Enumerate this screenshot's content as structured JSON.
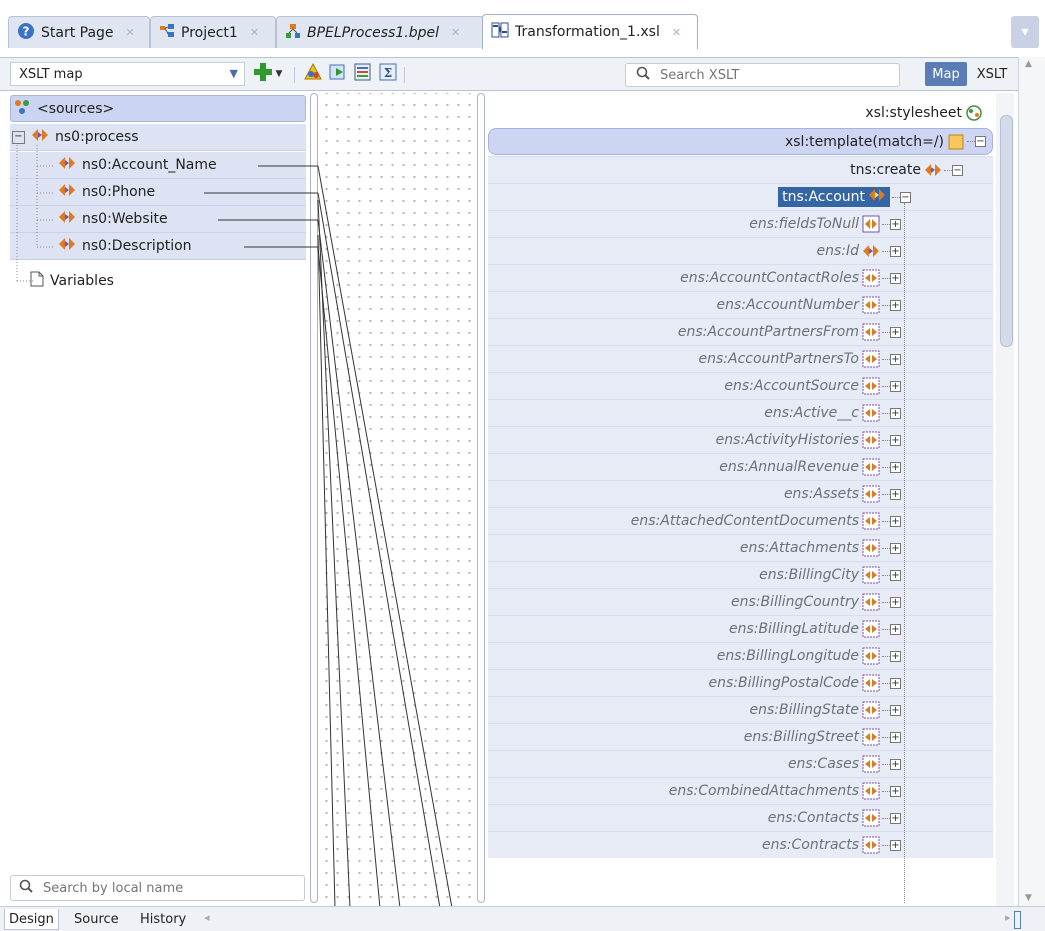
{
  "tabs": [
    {
      "label": "Start Page",
      "italic": false,
      "icon": "help-circle-icon"
    },
    {
      "label": "Project1",
      "italic": false,
      "icon": "project-icon"
    },
    {
      "label": "BPELProcess1.bpel",
      "italic": true,
      "icon": "bpel-process-icon"
    },
    {
      "label": "Transformation_1.xsl",
      "italic": false,
      "icon": "xsl-mapper-icon"
    }
  ],
  "toolbar": {
    "view_select": "XSLT map",
    "search_placeholder": "Search XSLT",
    "map_label": "Map",
    "xslt_label": "XSLT"
  },
  "source_tree": {
    "root": "<sources>",
    "process": "ns0:process",
    "elements": [
      "ns0:Account_Name",
      "ns0:Phone",
      "ns0:Website",
      "ns0:Description"
    ],
    "variables": "Variables",
    "search_placeholder": "Search by local name"
  },
  "target_tree": {
    "stylesheet": "xsl:stylesheet",
    "template": "xsl:template(match=/)",
    "create": "tns:create",
    "account": "tns:Account",
    "fields": [
      "ens:fieldsToNull",
      "ens:Id",
      "ens:AccountContactRoles",
      "ens:AccountNumber",
      "ens:AccountPartnersFrom",
      "ens:AccountPartnersTo",
      "ens:AccountSource",
      "ens:Active__c",
      "ens:ActivityHistories",
      "ens:AnnualRevenue",
      "ens:Assets",
      "ens:AttachedContentDocuments",
      "ens:Attachments",
      "ens:BillingCity",
      "ens:BillingCountry",
      "ens:BillingLatitude",
      "ens:BillingLongitude",
      "ens:BillingPostalCode",
      "ens:BillingState",
      "ens:BillingStreet",
      "ens:Cases",
      "ens:CombinedAttachments",
      "ens:Contacts",
      "ens:Contracts"
    ]
  },
  "bottom_tabs": [
    "Design",
    "Source",
    "History"
  ],
  "colors": {
    "accent": "#5b7db6",
    "selection": "#3465a4",
    "element_icon": "#e07a1f",
    "element_icon_outline": "#7a4fb0"
  }
}
